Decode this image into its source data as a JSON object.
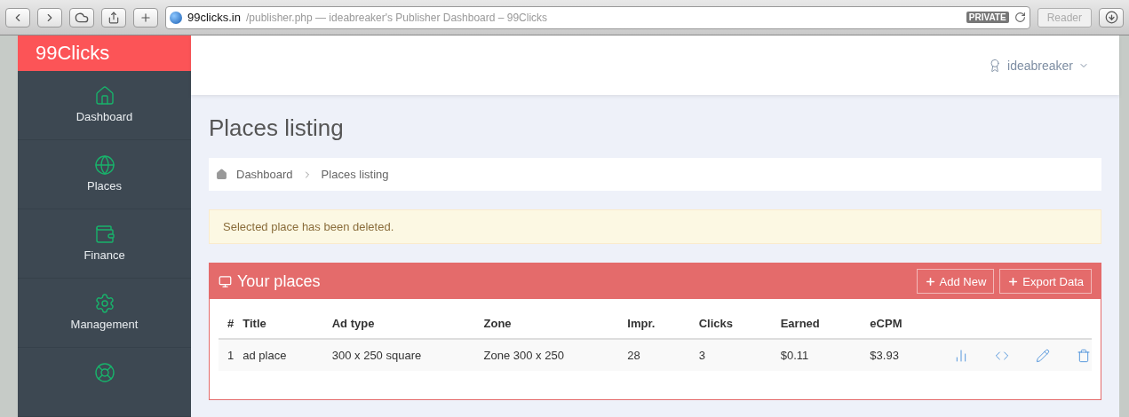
{
  "browser": {
    "domain": "99clicks.in",
    "path": "/publisher.php",
    "page_title": " — ideabreaker's Publisher Dashboard – 99Clicks",
    "badge": "PRIVATE",
    "reader": "Reader"
  },
  "sidebar": {
    "brand": "99Clicks",
    "items": [
      {
        "kind": "home",
        "label": "Dashboard"
      },
      {
        "kind": "globe",
        "label": "Places"
      },
      {
        "kind": "wallet",
        "label": "Finance"
      },
      {
        "kind": "gear",
        "label": "Management"
      },
      {
        "kind": "lifebuoy"
      }
    ]
  },
  "header": {
    "user": "ideabreaker"
  },
  "page_title": "Places listing",
  "breadcrumb": [
    "Dashboard",
    "Places listing"
  ],
  "alert": "Selected place has been deleted.",
  "panel": {
    "title": "Your places",
    "buttons": [
      "Add New",
      "Export Data"
    ],
    "table": {
      "columns": [
        "#",
        "Title",
        "Ad type",
        "Zone",
        "Impr.",
        "Clicks",
        "Earned",
        "eCPM"
      ],
      "rows": [
        {
          "cells": [
            "1",
            "ad place",
            "300 x 250 square",
            "Zone 300 x 250",
            "28",
            "3",
            "$0.11",
            "$3.93"
          ]
        }
      ]
    }
  }
}
